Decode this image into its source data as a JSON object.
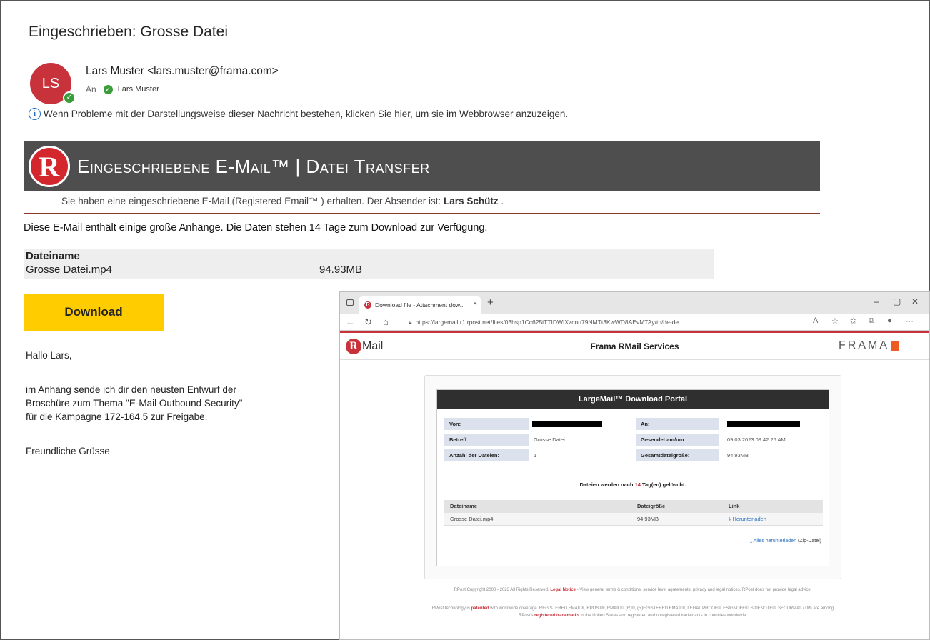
{
  "email": {
    "subject": "Eingeschrieben: Grosse Datei",
    "avatar_initials": "LS",
    "sender": "Lars Muster <lars.muster@frama.com>",
    "to_prefix": "An",
    "to_name": "Lars Muster",
    "info_text": "Wenn Probleme mit der Darstellungsweise dieser Nachricht bestehen, klicken Sie hier, um sie im Webbrowser anzuzeigen."
  },
  "banner": {
    "logo_letter": "R",
    "title": "Eingeschriebene E-Mail™ | Datei Transfer",
    "notice_prefix": "Sie haben eine eingeschriebene E-Mail (Registered Email™ ) erhalten. Der Absender ist:",
    "notice_sender": "Lars Schütz",
    "notice_suffix": "."
  },
  "message": {
    "intro": "Diese E-Mail enthält einige große Anhänge. Die Daten stehen 14 Tage zum Download zur Verfügung.",
    "files_header": "Dateiname",
    "file_name": "Grosse Datei.mp4",
    "file_size": "94.93MB",
    "download_label": "Download",
    "greeting": "Hallo Lars,",
    "body_lines": [
      "im Anhang sende ich dir den neusten Entwurf der",
      "Broschüre zum Thema \"E-Mail Outbound Security\"",
      "für die Kampagne 172-164.5 zur Freigabe."
    ],
    "closing": "Freundliche Grüsse"
  },
  "browser": {
    "tab_title": "Download file - Attachment dow...",
    "tab_close": "×",
    "new_tab": "+",
    "url": "https://largemail.r1.rpost.net/files/03hsp1Cc625iTTIDWIXzcnu79NMTt3KwWD8AEvMTAy/tn/de-de",
    "win_min": "–",
    "win_max": "▢",
    "win_close": "✕",
    "brand_logo_text": "Mail",
    "site_title": "Frama RMail Services",
    "frama_logo": "FRAMA",
    "portal_title": "LargeMail™ Download Portal",
    "labels": {
      "von": "Von:",
      "an": "An:",
      "betreff": "Betreff:",
      "gesendet": "Gesendet am/um:",
      "anzahl": "Anzahl der Dateien:",
      "gesamt": "Gesamtdateigröße:"
    },
    "values": {
      "betreff": "Grosse Datei",
      "gesendet": "09.03.2023 09:42:26 AM",
      "anzahl": "1",
      "gesamt": "94.93MB"
    },
    "delete_prefix": "Dateien werden nach",
    "delete_days": "14",
    "delete_suffix": "Tag(en) gelöscht.",
    "table_headers": [
      "Dateiname",
      "Dateigröße",
      "Link"
    ],
    "table_row": {
      "name": "Grosse Datei.mp4",
      "size": "94.93MB",
      "link": "Herunterladen"
    },
    "download_all": "Alles herunterladen",
    "download_all_suffix": "(Zip-Datei)",
    "footer_1_a": "RPost Copyright 2000 - 2023 All Rights Reserved.",
    "footer_1_link": "Legal Notice",
    "footer_1_b": "- View general terms & conditions, service level agreements, privacy and legal notices. RPost does not provide legal advice.",
    "footer_2_a": "RPost technology is",
    "footer_2_link1": "patented",
    "footer_2_b": "with worldwide coverage. REGISTERED EMAIL®, RPOST®, RMAIL®, (R)®, (R)EGISTERED EMAIL®, LEGAL PROOF®, ESIGNOFF®, SIDENOTE®, SECURMAIL(TM) are among RPost's",
    "footer_2_link2": "registered trademarks",
    "footer_2_c": "in the United States and registered and unregistered trademarks in countries worldwide."
  }
}
